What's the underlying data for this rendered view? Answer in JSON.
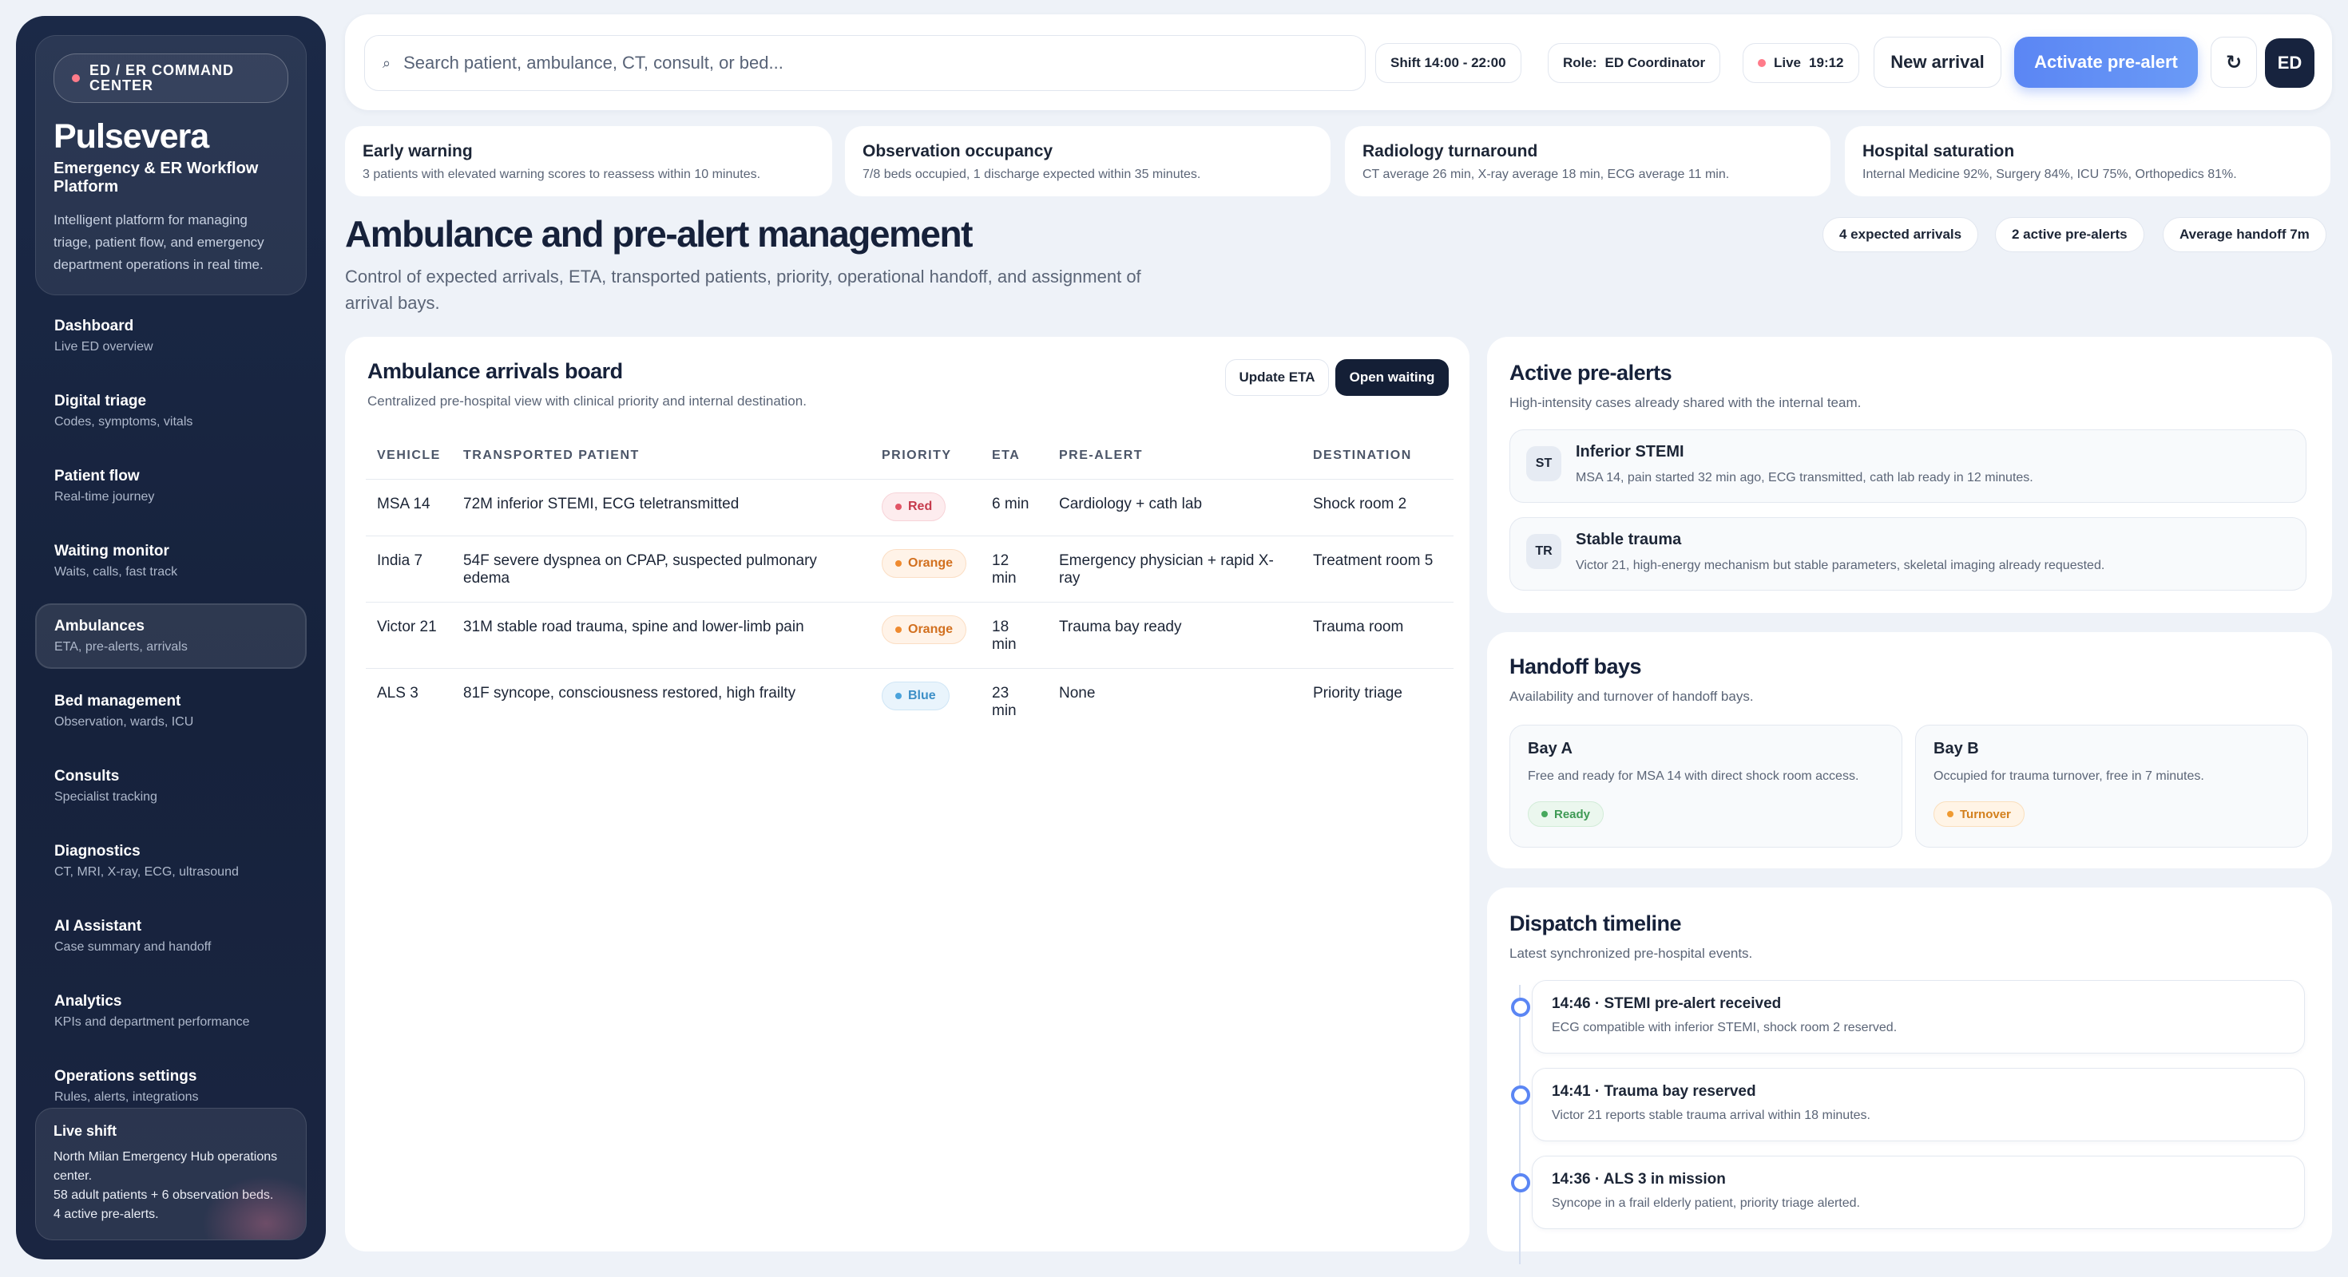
{
  "sidebar": {
    "tag": "ED / ER COMMAND CENTER",
    "brand": "Pulsevera",
    "subtitle": "Emergency & ER Workflow Platform",
    "description": "Intelligent platform for managing triage, patient flow, and emergency department operations in real time.",
    "items": [
      {
        "title": "Dashboard",
        "sub": "Live ED overview"
      },
      {
        "title": "Digital triage",
        "sub": "Codes, symptoms, vitals"
      },
      {
        "title": "Patient flow",
        "sub": "Real-time journey"
      },
      {
        "title": "Waiting monitor",
        "sub": "Waits, calls, fast track"
      },
      {
        "title": "Ambulances",
        "sub": "ETA, pre-alerts, arrivals"
      },
      {
        "title": "Bed management",
        "sub": "Observation, wards, ICU"
      },
      {
        "title": "Consults",
        "sub": "Specialist tracking"
      },
      {
        "title": "Diagnostics",
        "sub": "CT, MRI, X-ray, ECG, ultrasound"
      },
      {
        "title": "AI Assistant",
        "sub": "Case summary and handoff"
      },
      {
        "title": "Analytics",
        "sub": "KPIs and department performance"
      },
      {
        "title": "Operations settings",
        "sub": "Rules, alerts, integrations"
      }
    ],
    "live": {
      "title": "Live shift",
      "line1": "North Milan Emergency Hub operations center.",
      "line2": "58 adult patients + 6 observation beds.",
      "line3": "4 active pre-alerts."
    }
  },
  "topbar": {
    "search_placeholder": "Search patient, ambulance, CT, consult, or bed...",
    "search_icon": "⌕",
    "shift": "Shift 14:00 - 22:00",
    "role_label": "Role:",
    "role_value": "ED Coordinator",
    "live_label": "Live",
    "live_time": "19:12",
    "new_arrival": "New arrival",
    "activate": "Activate pre-alert",
    "refresh_icon": "↻",
    "avatar": "ED"
  },
  "kpis": [
    {
      "title": "Early warning",
      "sub": "3 patients with elevated warning scores to reassess within 10 minutes."
    },
    {
      "title": "Observation occupancy",
      "sub": "7/8 beds occupied, 1 discharge expected within 35 minutes."
    },
    {
      "title": "Radiology turnaround",
      "sub": "CT average 26 min, X-ray average 18 min, ECG average 11 min."
    },
    {
      "title": "Hospital saturation",
      "sub": "Internal Medicine 92%, Surgery 84%, ICU 75%, Orthopedics 81%."
    }
  ],
  "page": {
    "title": "Ambulance and pre-alert management",
    "description": "Control of expected arrivals, ETA, transported patients, priority, operational handoff, and assignment of arrival bays.",
    "pills": [
      "4 expected arrivals",
      "2 active pre-alerts",
      "Average handoff 7m"
    ]
  },
  "board": {
    "title": "Ambulance arrivals board",
    "sub": "Centralized pre-hospital view with clinical priority and internal destination.",
    "update_eta": "Update ETA",
    "open_waiting": "Open waiting",
    "columns": [
      "VEHICLE",
      "TRANSPORTED PATIENT",
      "PRIORITY",
      "ETA",
      "PRE-ALERT",
      "DESTINATION"
    ],
    "rows": [
      {
        "vehicle": "MSA 14",
        "patient": "72M inferior STEMI, ECG teletransmitted",
        "priority": "Red",
        "eta": "6 min",
        "prealert": "Cardiology + cath lab",
        "destination": "Shock room 2"
      },
      {
        "vehicle": "India 7",
        "patient": "54F severe dyspnea on CPAP, suspected pulmonary edema",
        "priority": "Orange",
        "eta": "12 min",
        "prealert": "Emergency physician + rapid X-ray",
        "destination": "Treatment room 5"
      },
      {
        "vehicle": "Victor 21",
        "patient": "31M stable road trauma, spine and lower-limb pain",
        "priority": "Orange",
        "eta": "18 min",
        "prealert": "Trauma bay ready",
        "destination": "Trauma room"
      },
      {
        "vehicle": "ALS 3",
        "patient": "81F syncope, consciousness restored, high frailty",
        "priority": "Blue",
        "eta": "23 min",
        "prealert": "None",
        "destination": "Priority triage"
      }
    ]
  },
  "prealerts": {
    "title": "Active pre-alerts",
    "sub": "High-intensity cases already shared with the internal team.",
    "items": [
      {
        "initials": "ST",
        "title": "Inferior STEMI",
        "sub": "MSA 14, pain started 32 min ago, ECG transmitted, cath lab ready in 12 minutes."
      },
      {
        "initials": "TR",
        "title": "Stable trauma",
        "sub": "Victor 21, high-energy mechanism but stable parameters, skeletal imaging already requested."
      }
    ]
  },
  "bays": {
    "title": "Handoff bays",
    "sub": "Availability and turnover of handoff bays.",
    "items": [
      {
        "title": "Bay A",
        "sub": "Free and ready for MSA 14 with direct shock room access.",
        "status": "Ready"
      },
      {
        "title": "Bay B",
        "sub": "Occupied for trauma turnover, free in 7 minutes.",
        "status": "Turnover"
      }
    ]
  },
  "timeline": {
    "title": "Dispatch timeline",
    "sub": "Latest synchronized pre-hospital events.",
    "items": [
      {
        "title": "14:46 · STEMI pre-alert received",
        "sub": "ECG compatible with inferior STEMI, shock room 2 reserved."
      },
      {
        "title": "14:41 · Trauma bay reserved",
        "sub": "Victor 21 reports stable trauma arrival within 18 minutes."
      },
      {
        "title": "14:36 · ALS 3 in mission",
        "sub": "Syncope in a frail elderly patient, priority triage alerted."
      }
    ]
  },
  "colors": {
    "accent": "#5b86f4",
    "sidebar_bg": "#1b2947",
    "red": "#e25566",
    "orange": "#ef8a2f",
    "blue": "#4ba3dc",
    "green": "#47a85d"
  }
}
